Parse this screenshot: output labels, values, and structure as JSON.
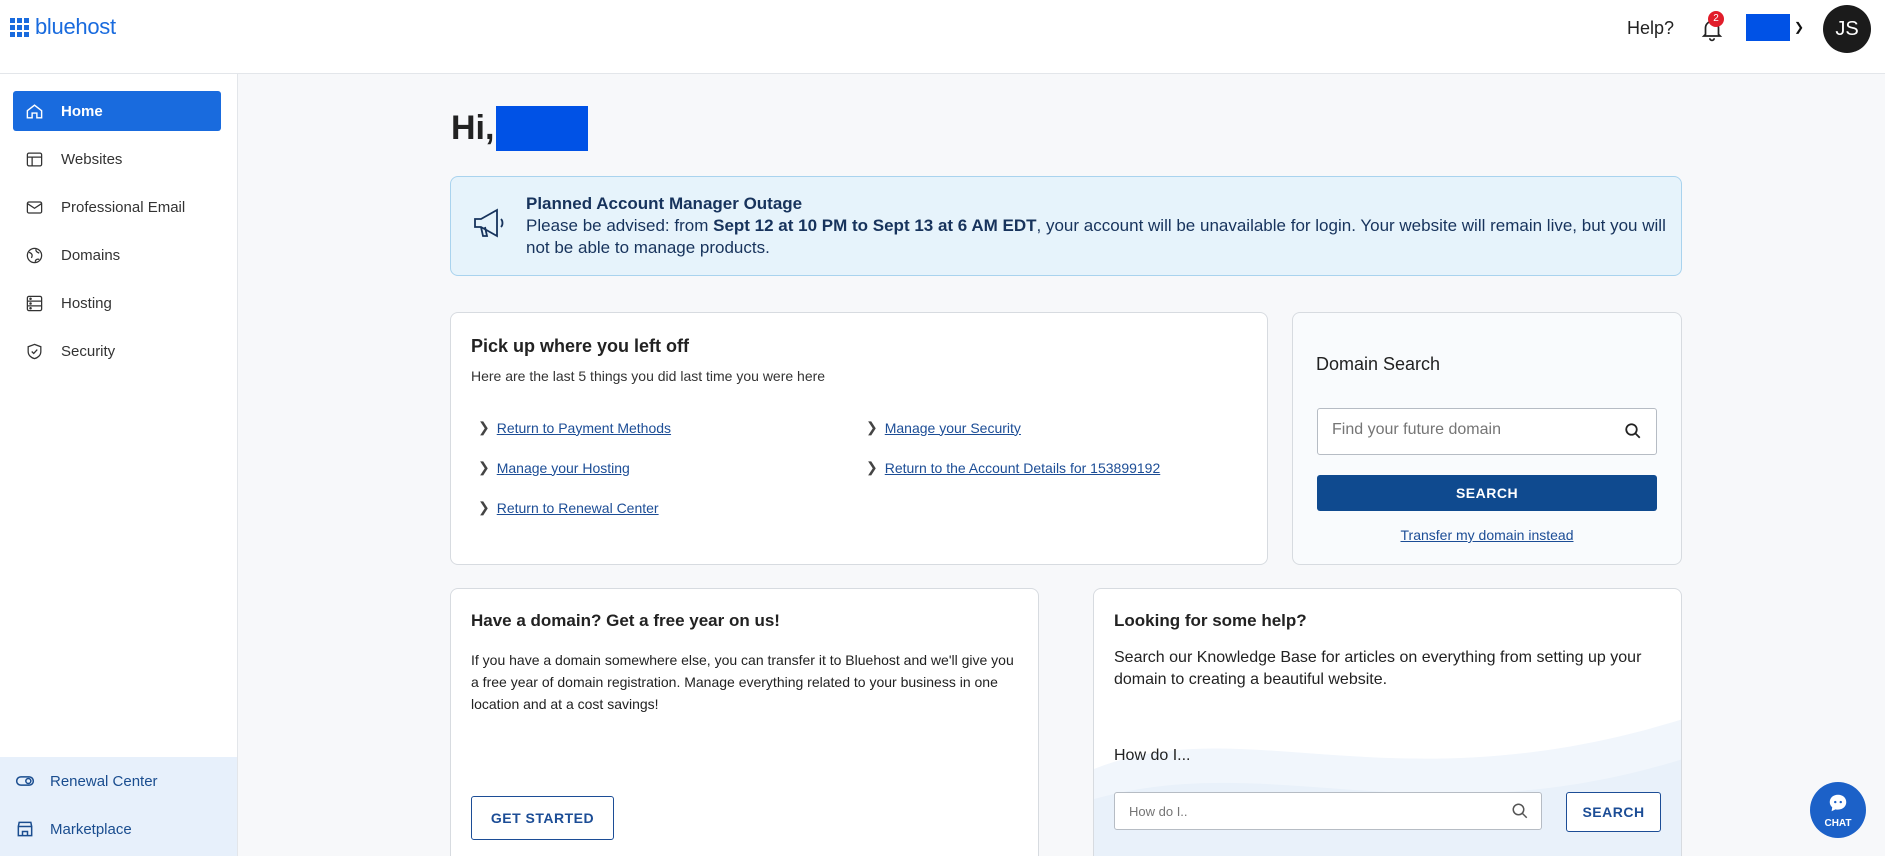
{
  "header": {
    "logo_text": "bluehost",
    "help_label": "Help?",
    "notification_count": "2",
    "avatar_initials": "JS"
  },
  "sidebar": {
    "items": [
      {
        "label": "Home",
        "icon": "home-icon",
        "active": true
      },
      {
        "label": "Websites",
        "icon": "websites-icon"
      },
      {
        "label": "Professional Email",
        "icon": "email-icon"
      },
      {
        "label": "Domains",
        "icon": "globe-icon"
      },
      {
        "label": "Hosting",
        "icon": "server-icon"
      },
      {
        "label": "Security",
        "icon": "shield-icon"
      }
    ],
    "bottom_items": [
      {
        "label": "Renewal Center",
        "icon": "toggle-icon"
      },
      {
        "label": "Marketplace",
        "icon": "store-icon"
      }
    ]
  },
  "main": {
    "greeting": "Hi,",
    "banner": {
      "title": "Planned Account Manager Outage",
      "text_before": "Please be advised: from ",
      "text_bold": "Sept 12 at 10 PM to Sept 13 at 6 AM EDT",
      "text_after": ", your account will be unavailable for login. Your website will remain live, but you will not be able to manage products."
    },
    "recent": {
      "title": "Pick up where you left off",
      "subtitle": "Here are the last 5 things you did last time you were here",
      "links": [
        "Return to Payment Methods",
        "Manage your Hosting",
        "Return to Renewal Center",
        "Manage your Security",
        "Return to the Account Details for 153899192"
      ]
    },
    "domain_search": {
      "title": "Domain Search",
      "placeholder": "Find your future domain",
      "button": "SEARCH",
      "transfer_link": "Transfer my domain instead"
    },
    "free_year": {
      "title": "Have a domain? Get a free year on us!",
      "text": "If you have a domain somewhere else, you can transfer it to Bluehost and we'll give you a free year of domain registration. Manage everything related to your business in one location and at a cost savings!",
      "button": "GET STARTED"
    },
    "help": {
      "title": "Looking for some help?",
      "text": "Search our Knowledge Base for articles on everything from setting up your domain to creating a beautiful website.",
      "how_label": "How do I...",
      "placeholder": "How do I..",
      "button": "SEARCH"
    },
    "chat_label": "CHAT"
  },
  "colors": {
    "brand_blue": "#196bde",
    "dark_blue": "#0f4a8f",
    "link_blue": "#1c4d96",
    "banner_bg": "#e6f3fb",
    "redaction": "#0052e6"
  }
}
